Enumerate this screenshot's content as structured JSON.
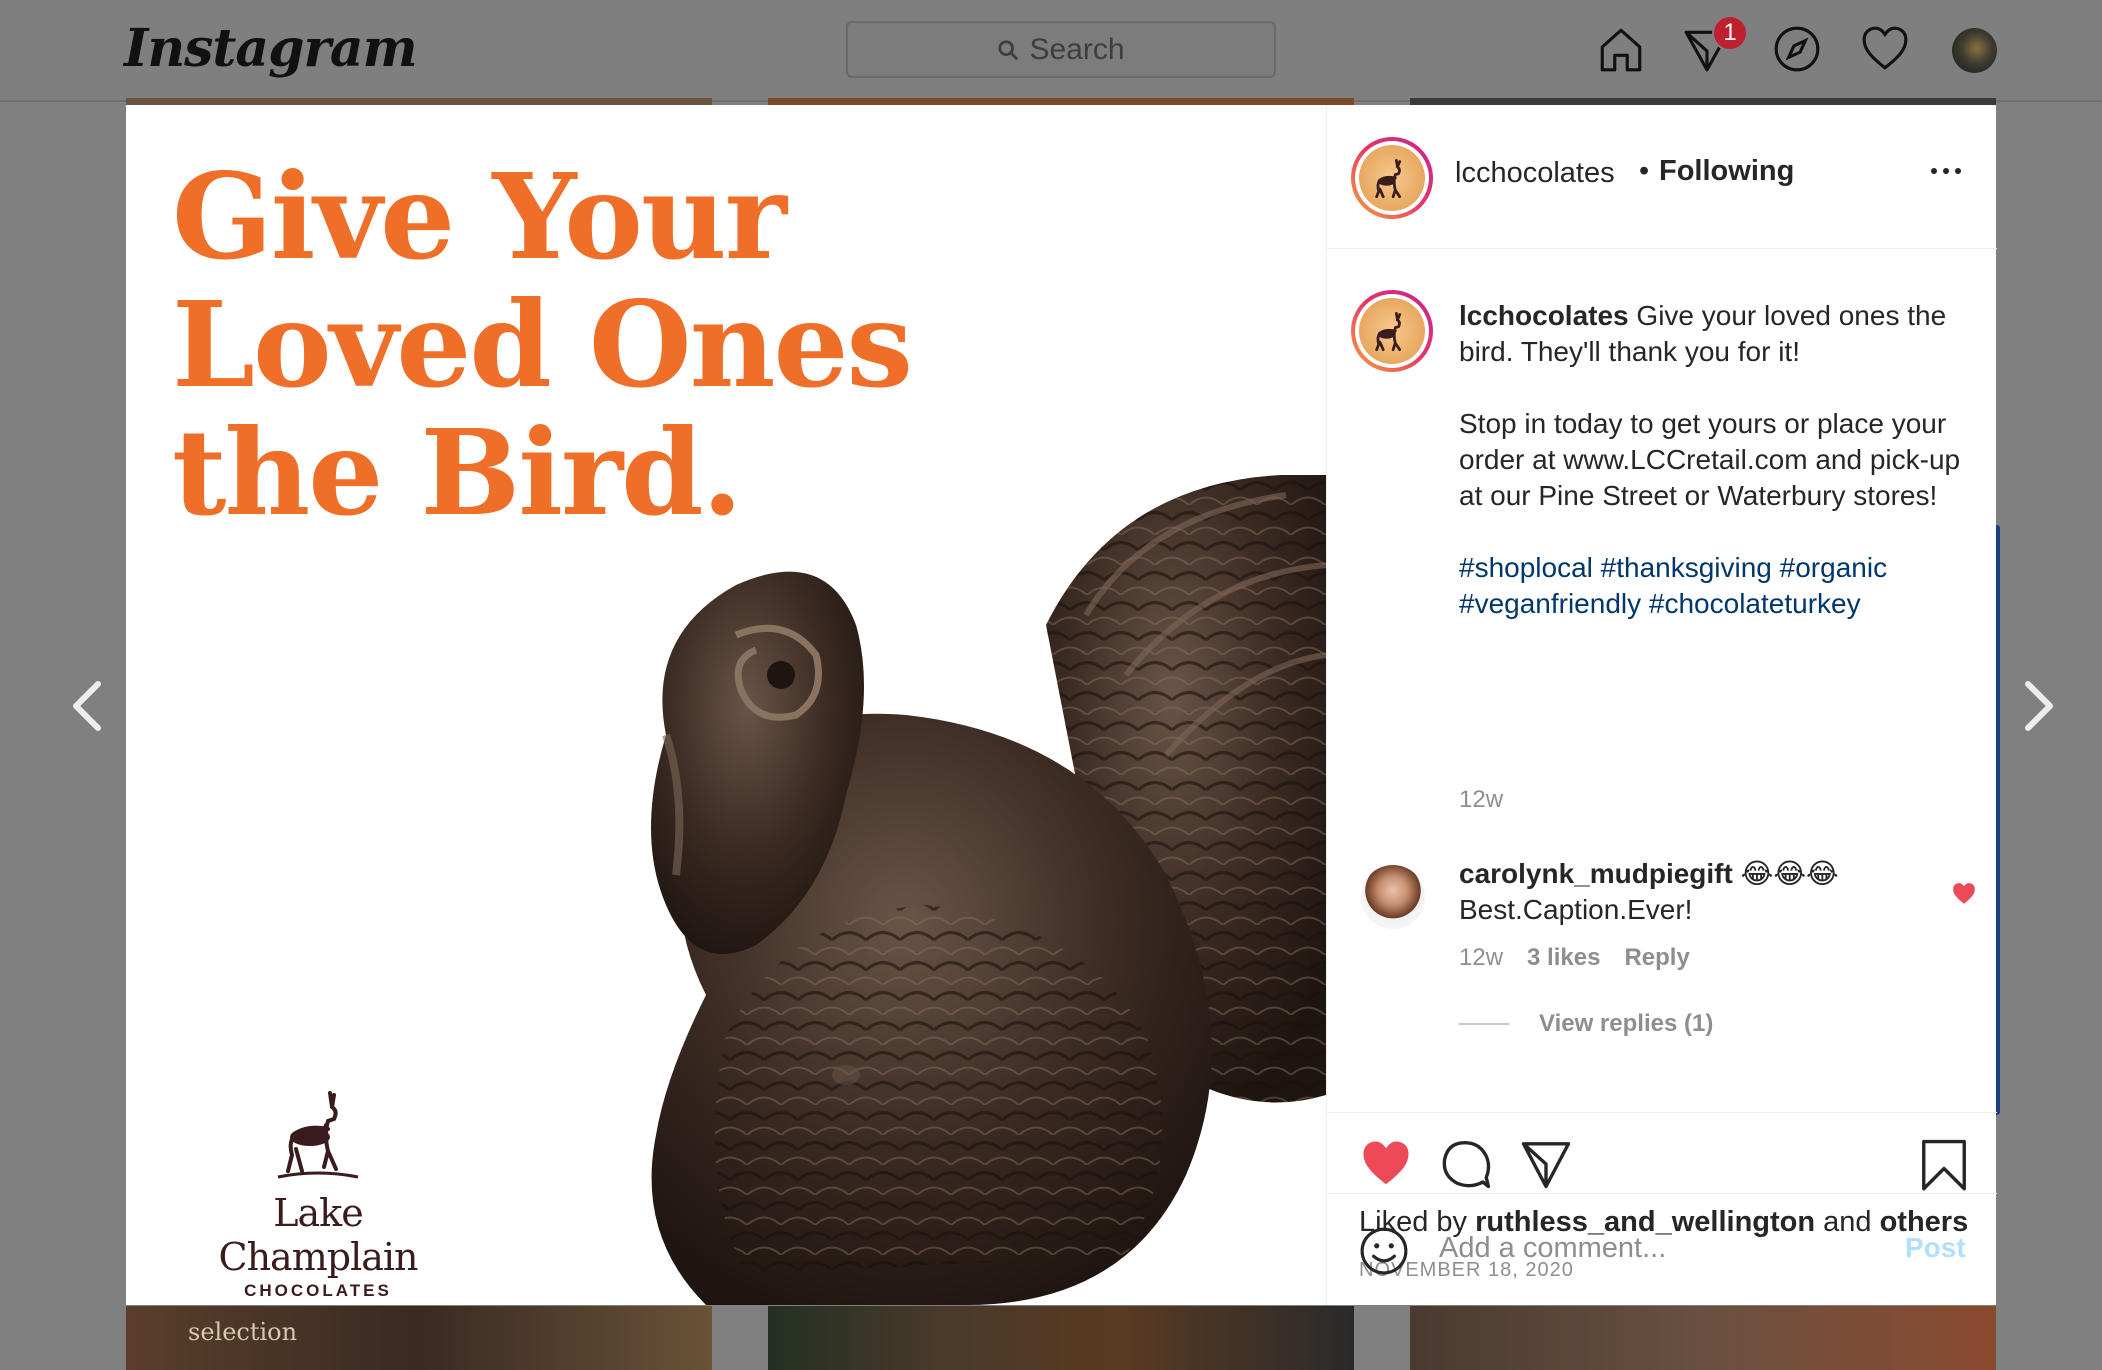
{
  "app": {
    "logo_text": "Instagram"
  },
  "topbar": {
    "search_placeholder": "Search",
    "notification_count": "1"
  },
  "post": {
    "image_headline": [
      "Give Your",
      "Loved Ones",
      "the Bird."
    ],
    "image_brand_name": "Lake Champlain",
    "image_brand_sub": "CHOCOLATES",
    "username": "lcchocolates",
    "follow_status": "Following",
    "caption_user": "lcchocolates",
    "caption_first": "Give your loved ones the bird. They'll thank you for it!",
    "caption_second": "Stop in today to get yours or place your order at www.LCCretail.com and pick-up at our Pine Street or Waterbury stores!",
    "hashtags": "#shoplocal #thanksgiving #organic #veganfriendly #chocolateturkey",
    "caption_time": "12w",
    "liked_by_prefix": "Liked by",
    "liked_by_user": "ruthless_and_wellington",
    "liked_by_and": "and",
    "liked_by_others": "others",
    "date": "NOVEMBER 18, 2020"
  },
  "comment": {
    "user": "carolynk_mudpiegift",
    "emoji": "😂😂😂",
    "text": "Best.Caption.Ever!",
    "time": "12w",
    "likes": "3 likes",
    "reply_label": "Reply",
    "view_replies": "View replies (1)"
  },
  "composer": {
    "placeholder": "Add a comment...",
    "post_label": "Post"
  },
  "background": {
    "grid_text": "selection"
  },
  "colors": {
    "accent_blue": "#00376b",
    "like_red": "#ed4956",
    "brand_orange": "#ef6f28",
    "post_button": "#b2dffc"
  },
  "icons": [
    "search-icon",
    "home-icon",
    "direct-icon",
    "explore-icon",
    "activity-heart-icon",
    "more-icon",
    "heart-icon",
    "comment-icon",
    "share-icon",
    "bookmark-icon",
    "smile-icon",
    "prev-arrow-icon",
    "next-arrow-icon"
  ]
}
